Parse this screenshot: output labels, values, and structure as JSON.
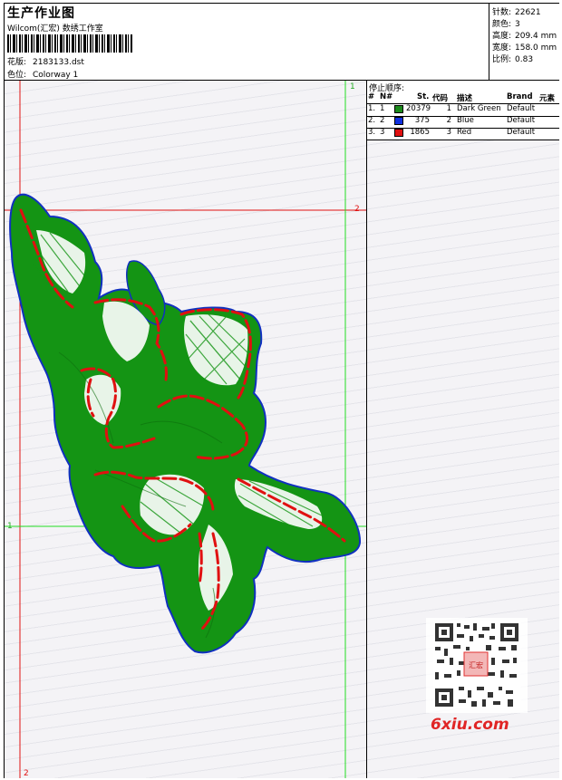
{
  "header": {
    "title": "生产作业图",
    "company": "Wilcom(汇宏) 数绣工作室",
    "design": {
      "label": "花版:",
      "value": "2183133.dst"
    },
    "colorway": {
      "label": "色位:",
      "value": "Colorway 1"
    }
  },
  "stats": [
    {
      "label": "针数:",
      "value": "22621"
    },
    {
      "label": "颜色:",
      "value": "3"
    },
    {
      "label": "高度:",
      "value": "209.4 mm"
    },
    {
      "label": "宽度:",
      "value": "158.0 mm"
    },
    {
      "label": "比例:",
      "value": "0.83"
    }
  ],
  "stop_sequence": {
    "title": "停止顺序:",
    "columns": {
      "num": "#",
      "n": "N#",
      "st": "St.",
      "code": "代码",
      "desc": "描述",
      "brand": "Brand",
      "element": "元素"
    },
    "rows": [
      {
        "num": "1.",
        "n": "1",
        "st": "20379",
        "code": "1",
        "desc": "Dark Green",
        "brand": "Default",
        "color": "#1a8a1a"
      },
      {
        "num": "2.",
        "n": "2",
        "st": "375",
        "code": "2",
        "desc": "Blue",
        "brand": "Default",
        "color": "#1030e0"
      },
      {
        "num": "3.",
        "n": "3",
        "st": "1865",
        "code": "3",
        "desc": "Red",
        "brand": "Default",
        "color": "#e01010"
      }
    ]
  },
  "markers": {
    "green_top": "1",
    "red_right": "2",
    "green_left": "1",
    "red_bottom": "2"
  },
  "colors": {
    "green_fill": "#149414",
    "outline": "#1030c0",
    "red_run": "#e01010",
    "guide_green": "#22dd22",
    "guide_red": "#e01010"
  },
  "watermark": {
    "text": "6xiu.com",
    "seal": "汇宏"
  }
}
